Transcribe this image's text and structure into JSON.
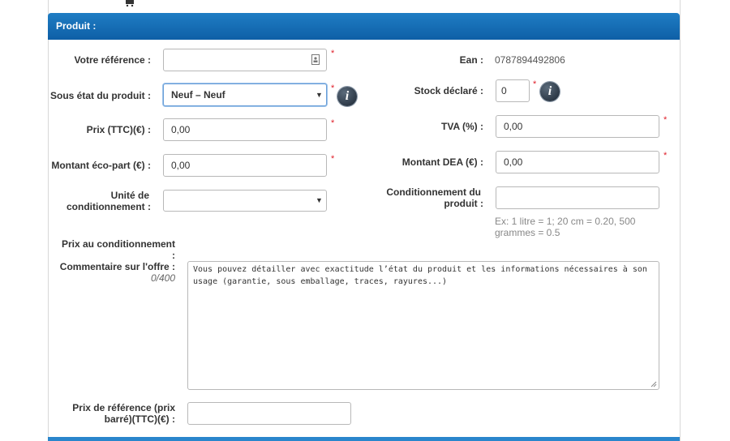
{
  "section_title": "Produit :",
  "fields": {
    "reference": {
      "label": "Votre référence :",
      "value": ""
    },
    "sous_etat": {
      "label": "Sous état du produit :",
      "value": "Neuf – Neuf"
    },
    "prix": {
      "label": "Prix (TTC)(€) :",
      "value": "0,00"
    },
    "ecopart": {
      "label": "Montant éco-part (€) :",
      "value": "0,00"
    },
    "unite": {
      "label_line1": "Unité de",
      "label_line2": "conditionnement :",
      "value": ""
    },
    "prix_cond": {
      "label_line1": "Prix au conditionnement",
      "label_line2": ":"
    },
    "commentaire": {
      "label": "Commentaire sur l'offre :",
      "counter": "0/400",
      "placeholder": "Vous pouvez détailler avec exactitude l’état du produit et les informations nécessaires à son usage (garantie, sous emballage, traces, rayures...)"
    },
    "prix_ref": {
      "label_line1": "Prix de référence (prix",
      "label_line2": "barré)(TTC)(€) :",
      "value": ""
    },
    "ean": {
      "label": "Ean :",
      "value": "0787894492806"
    },
    "stock": {
      "label": "Stock déclaré :",
      "value": "0"
    },
    "tva": {
      "label": "TVA (%) :",
      "value": "0,00"
    },
    "dea": {
      "label": "Montant DEA (€) :",
      "value": "0,00"
    },
    "cond_produit": {
      "label_line1": "Conditionnement du",
      "label_line2": "produit :",
      "value": "",
      "hint_line1": "Ex: 1 litre = 1; 20 cm = 0.20, 500",
      "hint_line2": "grammes = 0.5"
    }
  },
  "required_mark": "*",
  "info_icon_text": "i",
  "colors": {
    "header": "#0e5fa6",
    "required": "#e0202a",
    "focus_border": "#6a9fd8"
  }
}
